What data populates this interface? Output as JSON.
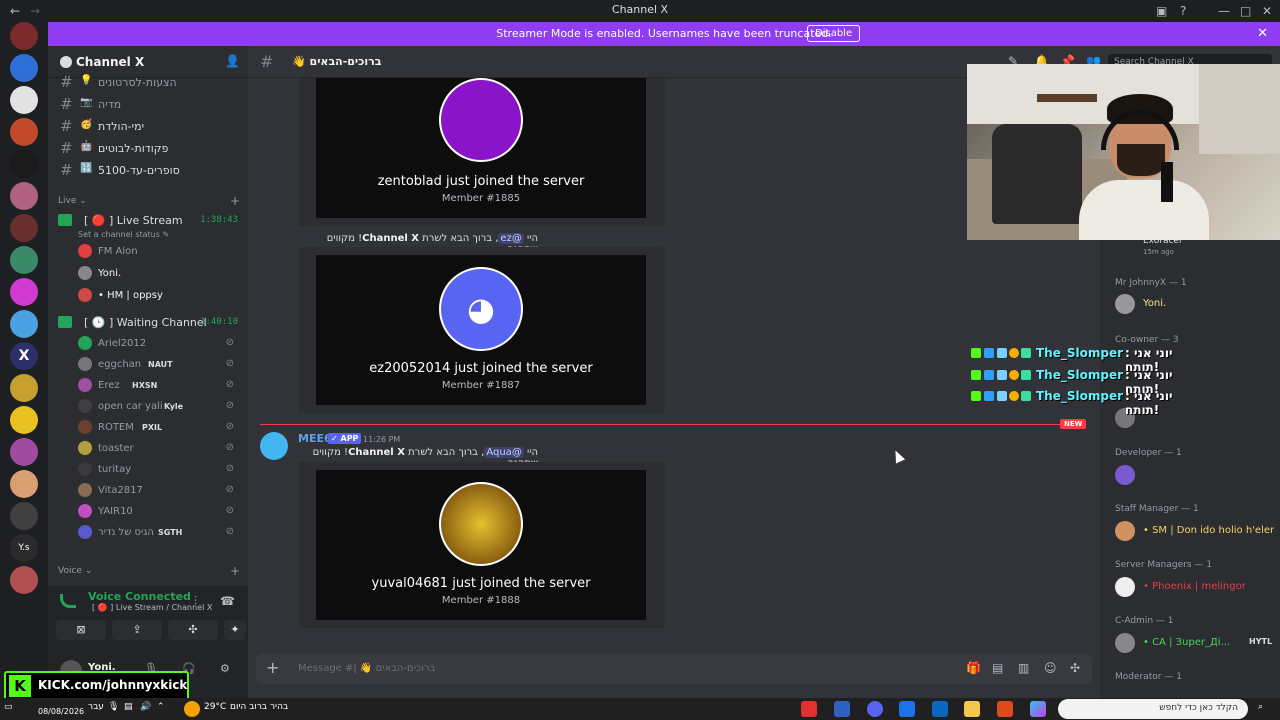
{
  "window": {
    "title": "Channel X"
  },
  "banner": {
    "text": "Streamer Mode is enabled. Usernames have been truncated.",
    "button": "Disable"
  },
  "server": {
    "name": "Channel X"
  },
  "channels": [
    {
      "label": "הצעות-לסרטונים",
      "emoji": "💡"
    },
    {
      "label": "מדיה",
      "emoji": "📷"
    },
    {
      "label": "ימי-הולדת",
      "emoji": "🥳"
    },
    {
      "label": "פקודות-לבוטים",
      "emoji": "🤖"
    },
    {
      "label": "סופרים-עד-5100",
      "emoji": "🔢"
    }
  ],
  "live_category": "Live",
  "voice_channels": [
    {
      "label": "Live Stream",
      "time": "1:38:43",
      "status": "Set a channel status"
    },
    {
      "label": "Waiting Channel",
      "time": "1:40:10"
    }
  ],
  "live_users": [
    {
      "name": "FM Alon"
    },
    {
      "name": "Yoni."
    },
    {
      "name": "• HM | oppsy"
    }
  ],
  "waiting_users": [
    {
      "name": "Ariel2012",
      "tag": ""
    },
    {
      "name": "eggchan",
      "tag": "NAUT"
    },
    {
      "name": "Erez",
      "tag": "HXSN"
    },
    {
      "name": "open car yali",
      "tag": "Kyle"
    },
    {
      "name": "ROTEM",
      "tag": "PXIL"
    },
    {
      "name": "toaster",
      "tag": ""
    },
    {
      "name": "turitay",
      "tag": ""
    },
    {
      "name": "Vita2817",
      "tag": ""
    },
    {
      "name": "YAIR10",
      "tag": ""
    },
    {
      "name": "הגיס של נדיר",
      "tag": "SGTH"
    }
  ],
  "voice_category": "Voice",
  "voice_panel": {
    "status": "Voice Connected",
    "location": "Live Stream / Channel X"
  },
  "user_panel": {
    "name": "Yoni."
  },
  "kick_overlay": {
    "text": "KICK.com/johnnyxkick"
  },
  "channel_header": {
    "name": "ברוכים-הבאים",
    "search_placeholder": "Search Channel X"
  },
  "messages": {
    "card1": {
      "joined": "zentoblad just joined the server",
      "member": "Member #1885"
    },
    "welcome2": {
      "pre": "היי ",
      "mention": "@ez",
      "mid": ", ברוך הבא לשרת ",
      "server": "Channel X",
      "post": "! מקווים שתהנה"
    },
    "card2": {
      "joined": "ez20052014 just joined the server",
      "member": "Member #1887"
    },
    "mee6": {
      "author": "MEE6",
      "badge": "APP",
      "time": "11:26 PM",
      "new_tag": "NEW"
    },
    "welcome3": {
      "pre": "היי ",
      "mention": "@Aqua",
      "mid": ", ברוך הבא לשרת ",
      "server": "Channel X",
      "post": "! מקווים שתהנה"
    },
    "card3": {
      "joined": "yuval04681 just joined the server",
      "member": "Member #1888"
    }
  },
  "composer": {
    "placeholder": "Message #| 👋 ברוכים-הבאים"
  },
  "members": [
    {
      "category": "",
      "name": "Exoracer",
      "sub": "15m ago"
    },
    {
      "category": "Mr JohnnyX — 1",
      "name": "Yoni.",
      "color": "#f0e58a"
    },
    {
      "category": "Co-owner — 3",
      "name": "",
      "color": "#7a5af0"
    },
    {
      "category": "Developer — 1",
      "name": "",
      "color": "#a67cff"
    },
    {
      "category": "Staff Manager — 1",
      "name": "• SM | Don ido holio h'eler",
      "color": "#f5d36a"
    },
    {
      "category": "Server Managers — 1",
      "name": "• Phoenix | melingor",
      "color": "#e0404a"
    },
    {
      "category": "C-Admin — 1",
      "name": "• CA | Зuper_Ді...",
      "color": "#48d45a",
      "tag": "HYTL"
    },
    {
      "category": "Moderator — 1",
      "name": ""
    }
  ],
  "overlay_chat": [
    {
      "name": "The_Slomper",
      "msg": ": יוני אני תותח!"
    },
    {
      "name": "The_Slomper",
      "msg": ": יוני אני תותח!"
    },
    {
      "name": "The_Slomper",
      "msg": ": יוני אני תותח!"
    }
  ],
  "taskbar": {
    "weather": "29°C",
    "weather_text": "בהיר ברוב היום",
    "lang": "עבר",
    "date": "08/08/2026",
    "search": "הקלד כאן כדי לחפש"
  }
}
